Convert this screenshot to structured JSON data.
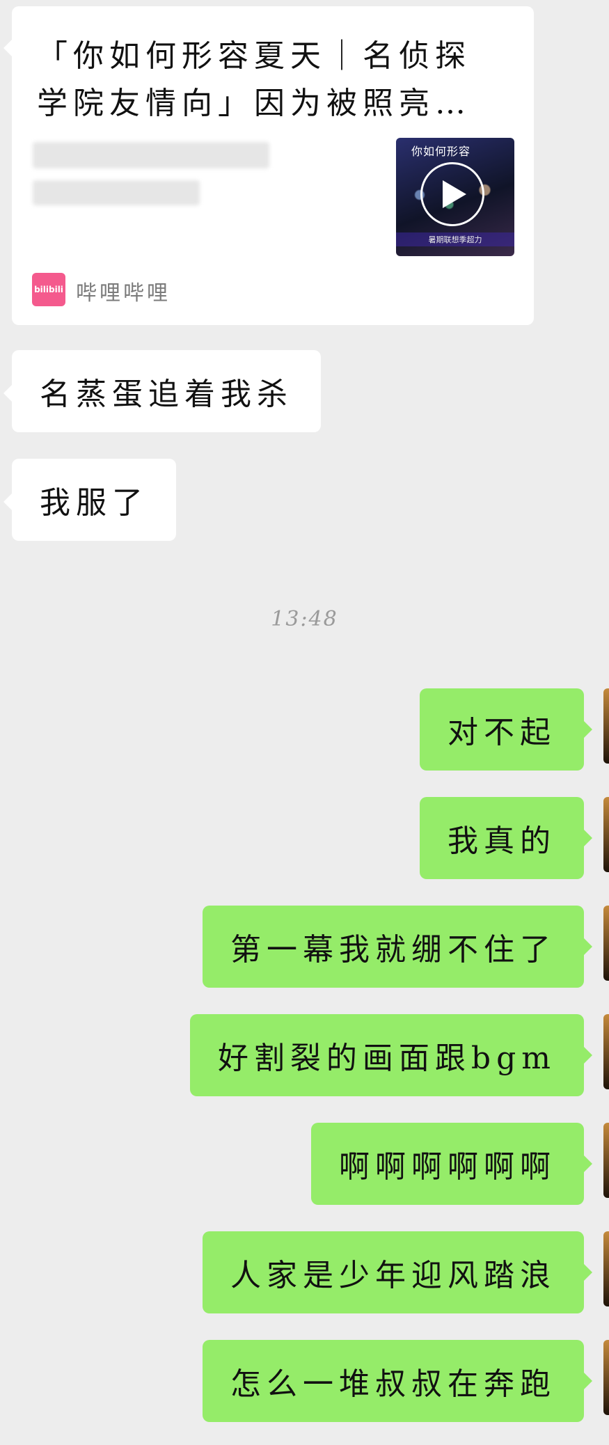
{
  "video_card": {
    "title": "「你如何形容夏天｜名侦探学院友情向」因为被照亮…",
    "thumbnail_banner": "你如何形容",
    "thumbnail_caption": "暑期联想季超力",
    "source_icon_text": "bilibili",
    "source_name": "哔哩哔哩",
    "play_icon": "play-icon"
  },
  "incoming_messages": [
    {
      "text": "名蒸蛋追着我杀"
    },
    {
      "text": "我服了"
    }
  ],
  "timestamp": "13:48",
  "outgoing_messages": [
    {
      "text": "对不起"
    },
    {
      "text": "我真的"
    },
    {
      "text": "第一幕我就绷不住了"
    },
    {
      "text": "好割裂的画面跟bgm"
    },
    {
      "text": "啊啊啊啊啊啊"
    },
    {
      "text": "人家是少年迎风踏浪"
    },
    {
      "text": "怎么一堆叔叔在奔跑"
    }
  ],
  "colors": {
    "background": "#ededed",
    "incoming_bubble": "#ffffff",
    "outgoing_bubble": "#95ec69",
    "bilibili_pink": "#f45a8d"
  }
}
